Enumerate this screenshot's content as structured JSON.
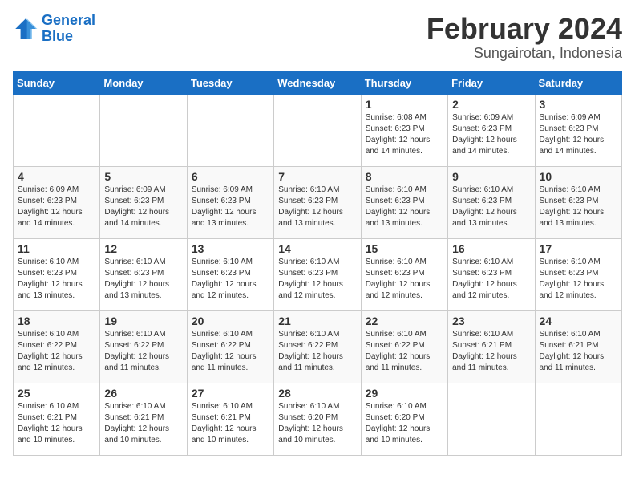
{
  "logo": {
    "line1": "General",
    "line2": "Blue"
  },
  "title": "February 2024",
  "subtitle": "Sungairotan, Indonesia",
  "days_of_week": [
    "Sunday",
    "Monday",
    "Tuesday",
    "Wednesday",
    "Thursday",
    "Friday",
    "Saturday"
  ],
  "weeks": [
    [
      {
        "day": "",
        "info": ""
      },
      {
        "day": "",
        "info": ""
      },
      {
        "day": "",
        "info": ""
      },
      {
        "day": "",
        "info": ""
      },
      {
        "day": "1",
        "info": "Sunrise: 6:08 AM\nSunset: 6:23 PM\nDaylight: 12 hours\nand 14 minutes."
      },
      {
        "day": "2",
        "info": "Sunrise: 6:09 AM\nSunset: 6:23 PM\nDaylight: 12 hours\nand 14 minutes."
      },
      {
        "day": "3",
        "info": "Sunrise: 6:09 AM\nSunset: 6:23 PM\nDaylight: 12 hours\nand 14 minutes."
      }
    ],
    [
      {
        "day": "4",
        "info": "Sunrise: 6:09 AM\nSunset: 6:23 PM\nDaylight: 12 hours\nand 14 minutes."
      },
      {
        "day": "5",
        "info": "Sunrise: 6:09 AM\nSunset: 6:23 PM\nDaylight: 12 hours\nand 14 minutes."
      },
      {
        "day": "6",
        "info": "Sunrise: 6:09 AM\nSunset: 6:23 PM\nDaylight: 12 hours\nand 13 minutes."
      },
      {
        "day": "7",
        "info": "Sunrise: 6:10 AM\nSunset: 6:23 PM\nDaylight: 12 hours\nand 13 minutes."
      },
      {
        "day": "8",
        "info": "Sunrise: 6:10 AM\nSunset: 6:23 PM\nDaylight: 12 hours\nand 13 minutes."
      },
      {
        "day": "9",
        "info": "Sunrise: 6:10 AM\nSunset: 6:23 PM\nDaylight: 12 hours\nand 13 minutes."
      },
      {
        "day": "10",
        "info": "Sunrise: 6:10 AM\nSunset: 6:23 PM\nDaylight: 12 hours\nand 13 minutes."
      }
    ],
    [
      {
        "day": "11",
        "info": "Sunrise: 6:10 AM\nSunset: 6:23 PM\nDaylight: 12 hours\nand 13 minutes."
      },
      {
        "day": "12",
        "info": "Sunrise: 6:10 AM\nSunset: 6:23 PM\nDaylight: 12 hours\nand 13 minutes."
      },
      {
        "day": "13",
        "info": "Sunrise: 6:10 AM\nSunset: 6:23 PM\nDaylight: 12 hours\nand 12 minutes."
      },
      {
        "day": "14",
        "info": "Sunrise: 6:10 AM\nSunset: 6:23 PM\nDaylight: 12 hours\nand 12 minutes."
      },
      {
        "day": "15",
        "info": "Sunrise: 6:10 AM\nSunset: 6:23 PM\nDaylight: 12 hours\nand 12 minutes."
      },
      {
        "day": "16",
        "info": "Sunrise: 6:10 AM\nSunset: 6:23 PM\nDaylight: 12 hours\nand 12 minutes."
      },
      {
        "day": "17",
        "info": "Sunrise: 6:10 AM\nSunset: 6:23 PM\nDaylight: 12 hours\nand 12 minutes."
      }
    ],
    [
      {
        "day": "18",
        "info": "Sunrise: 6:10 AM\nSunset: 6:22 PM\nDaylight: 12 hours\nand 12 minutes."
      },
      {
        "day": "19",
        "info": "Sunrise: 6:10 AM\nSunset: 6:22 PM\nDaylight: 12 hours\nand 11 minutes."
      },
      {
        "day": "20",
        "info": "Sunrise: 6:10 AM\nSunset: 6:22 PM\nDaylight: 12 hours\nand 11 minutes."
      },
      {
        "day": "21",
        "info": "Sunrise: 6:10 AM\nSunset: 6:22 PM\nDaylight: 12 hours\nand 11 minutes."
      },
      {
        "day": "22",
        "info": "Sunrise: 6:10 AM\nSunset: 6:22 PM\nDaylight: 12 hours\nand 11 minutes."
      },
      {
        "day": "23",
        "info": "Sunrise: 6:10 AM\nSunset: 6:21 PM\nDaylight: 12 hours\nand 11 minutes."
      },
      {
        "day": "24",
        "info": "Sunrise: 6:10 AM\nSunset: 6:21 PM\nDaylight: 12 hours\nand 11 minutes."
      }
    ],
    [
      {
        "day": "25",
        "info": "Sunrise: 6:10 AM\nSunset: 6:21 PM\nDaylight: 12 hours\nand 10 minutes."
      },
      {
        "day": "26",
        "info": "Sunrise: 6:10 AM\nSunset: 6:21 PM\nDaylight: 12 hours\nand 10 minutes."
      },
      {
        "day": "27",
        "info": "Sunrise: 6:10 AM\nSunset: 6:21 PM\nDaylight: 12 hours\nand 10 minutes."
      },
      {
        "day": "28",
        "info": "Sunrise: 6:10 AM\nSunset: 6:20 PM\nDaylight: 12 hours\nand 10 minutes."
      },
      {
        "day": "29",
        "info": "Sunrise: 6:10 AM\nSunset: 6:20 PM\nDaylight: 12 hours\nand 10 minutes."
      },
      {
        "day": "",
        "info": ""
      },
      {
        "day": "",
        "info": ""
      }
    ]
  ]
}
